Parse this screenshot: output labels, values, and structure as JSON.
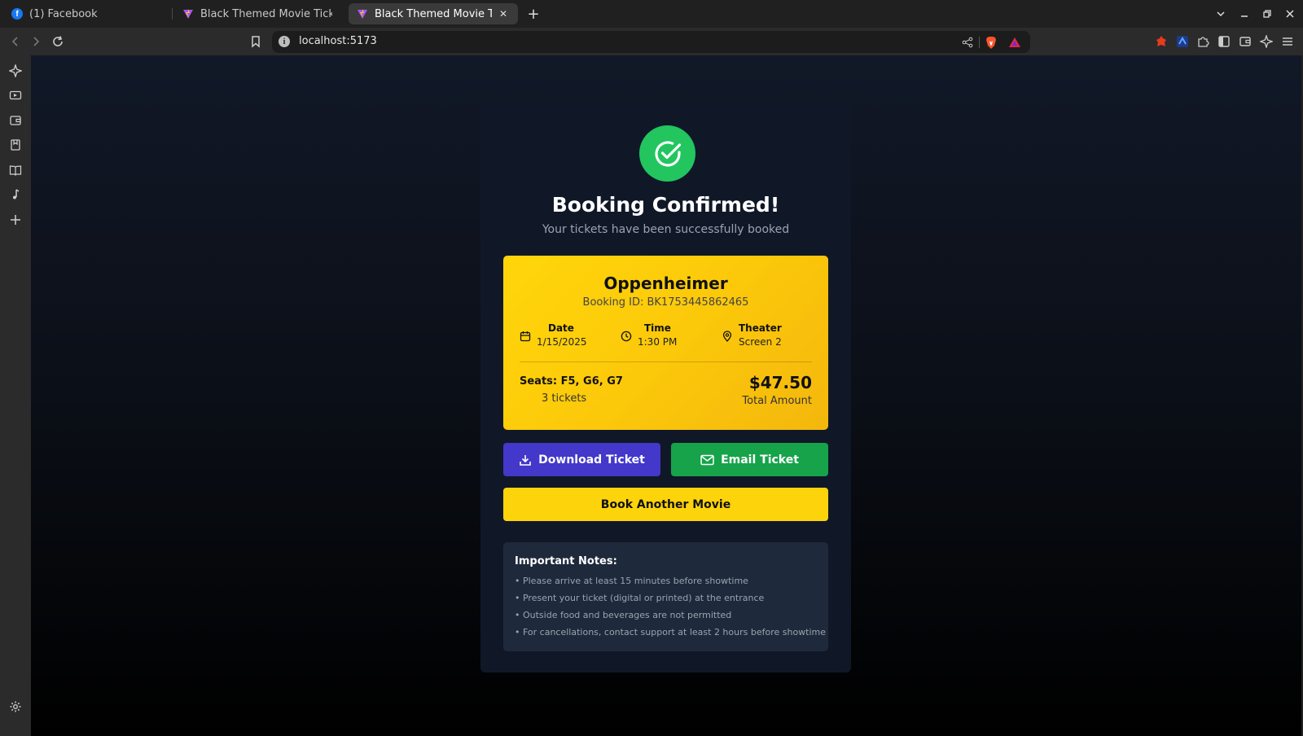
{
  "browser": {
    "tabs": [
      {
        "title": "(1) Facebook",
        "icon": "facebook-icon"
      },
      {
        "title": "Black Themed Movie Ticket B",
        "icon": "vite-icon"
      },
      {
        "title": "Black Themed Movie Ticke",
        "icon": "vite-icon",
        "active": true
      }
    ],
    "address": "localhost:5173"
  },
  "page": {
    "title": "Booking Confirmed!",
    "subtitle": "Your tickets have been successfully booked",
    "ticket": {
      "movie": "Oppenheimer",
      "booking_id": "Booking ID: BK1753445862465",
      "date_label": "Date",
      "date_value": "1/15/2025",
      "time_label": "Time",
      "time_value": "1:30 PM",
      "theater_label": "Theater",
      "theater_value": "Screen 2",
      "seats": "Seats: F5, G6, G7",
      "ticket_count": "3 tickets",
      "total_price": "$47.50",
      "total_label": "Total Amount"
    },
    "buttons": {
      "download": "Download Ticket",
      "email": "Email Ticket",
      "book_another": "Book Another Movie"
    },
    "notes": {
      "title": "Important Notes:",
      "items": [
        "• Please arrive at least 15 minutes before showtime",
        "• Present your ticket (digital or printed) at the entrance",
        "• Outside food and beverages are not permitted",
        "• For cancellations, contact support at least 2 hours before showtime"
      ]
    }
  },
  "colors": {
    "success": "#22c55e",
    "ticket_gold": "#fcc90a",
    "download_button": "#4338ca",
    "email_button": "#16a34a",
    "book_button": "#fdd30b",
    "panel": "#101828",
    "notes_bg": "#1e293b"
  }
}
